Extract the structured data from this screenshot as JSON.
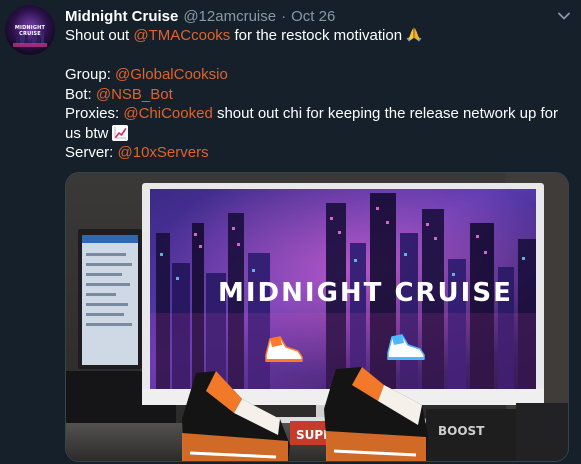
{
  "tweet": {
    "avatar_alt": "Midnight Cruise logo avatar",
    "avatar_text": "MIDNIGHT CRUISE",
    "display_name": "Midnight Cruise",
    "handle": "@12amcruise",
    "separator": "·",
    "date": "Oct 26",
    "body": {
      "line1_text": "Shout out ",
      "line1_mention": "@TMACcooks",
      "line1_rest": " for the restock motivation",
      "line1_emoji": "folded-hands-emoji",
      "group_label": "Group: ",
      "group_mention": "@GlobalCooksio",
      "bot_label": "Bot: ",
      "bot_mention": "@NSB_Bot",
      "proxies_label": "Proxies: ",
      "proxies_mention": "@ChiCooked",
      "proxies_rest": " shout out chi for keeping the release network up for us btw",
      "proxies_emoji": "chart-increasing-emoji",
      "server_label": "Server: ",
      "server_mention": "@10xServers"
    },
    "media": {
      "description": "Monitor displaying neon city wallpaper with sneaker icons; pair of orange and black sneakers in front",
      "screen_text": "MIDNIGHT CRUISE",
      "box_text": "BOOST",
      "box_text2": "SUPRE"
    },
    "colors": {
      "background": "#15202b",
      "link": "#e0632a",
      "text": "#ffffff",
      "muted": "#8899a6"
    }
  }
}
